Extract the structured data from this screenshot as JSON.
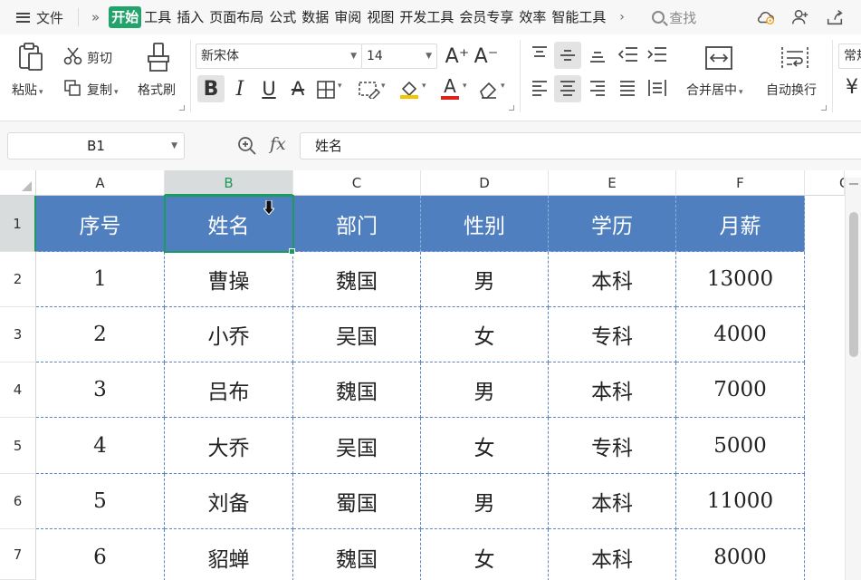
{
  "topbar": {
    "file_label": "文件",
    "more_symbol": "»",
    "tabs": [
      "开始",
      "工具",
      "插入",
      "页面布局",
      "公式",
      "数据",
      "审阅",
      "视图",
      "开发工具",
      "会员专享",
      "效率",
      "智能工具"
    ],
    "tab_scroll_symbol": "›",
    "search_label": "查找",
    "icons": [
      "cloud-sync-icon",
      "add-user-icon",
      "share-icon"
    ]
  },
  "ribbon": {
    "paste_label": "粘贴",
    "cut_label": "剪切",
    "copy_label": "复制",
    "format_painter_label": "格式刷",
    "font_name": "新宋体",
    "font_size": "14",
    "grow_font": "A⁺",
    "shrink_font": "A⁻",
    "bold": "B",
    "italic": "I",
    "underline": "U",
    "strike": "A",
    "font_color_glyph": "A",
    "merge_center_label": "合并居中",
    "wrap_text_label": "自动换行",
    "number_format_label": "常规",
    "currency_symbol": "¥",
    "colors": {
      "highlight_fill": "#f5c400",
      "font_color": "#e0201b"
    }
  },
  "formula_bar": {
    "name_box": "B1",
    "fx_label": "fx",
    "formula": "姓名"
  },
  "sheet": {
    "columns": [
      "A",
      "B",
      "C",
      "D",
      "E",
      "F",
      "G"
    ],
    "selected_column": "B",
    "rows": [
      "1",
      "2",
      "3",
      "4",
      "5",
      "6",
      "7"
    ],
    "selected_row": "1",
    "selected_cell": "B1",
    "header_fill": "#4f7fbf",
    "accent": "#1e9a5e",
    "table": {
      "headers": [
        "序号",
        "姓名",
        "部门",
        "性别",
        "学历",
        "月薪"
      ],
      "records": [
        [
          "1",
          "曹操",
          "魏国",
          "男",
          "本科",
          "13000"
        ],
        [
          "2",
          "小乔",
          "吴国",
          "女",
          "专科",
          "4000"
        ],
        [
          "3",
          "吕布",
          "魏国",
          "男",
          "本科",
          "7000"
        ],
        [
          "4",
          "大乔",
          "吴国",
          "女",
          "专科",
          "5000"
        ],
        [
          "5",
          "刘备",
          "蜀国",
          "男",
          "本科",
          "11000"
        ],
        [
          "6",
          "貂蝉",
          "魏国",
          "女",
          "本科",
          "8000"
        ]
      ]
    }
  }
}
